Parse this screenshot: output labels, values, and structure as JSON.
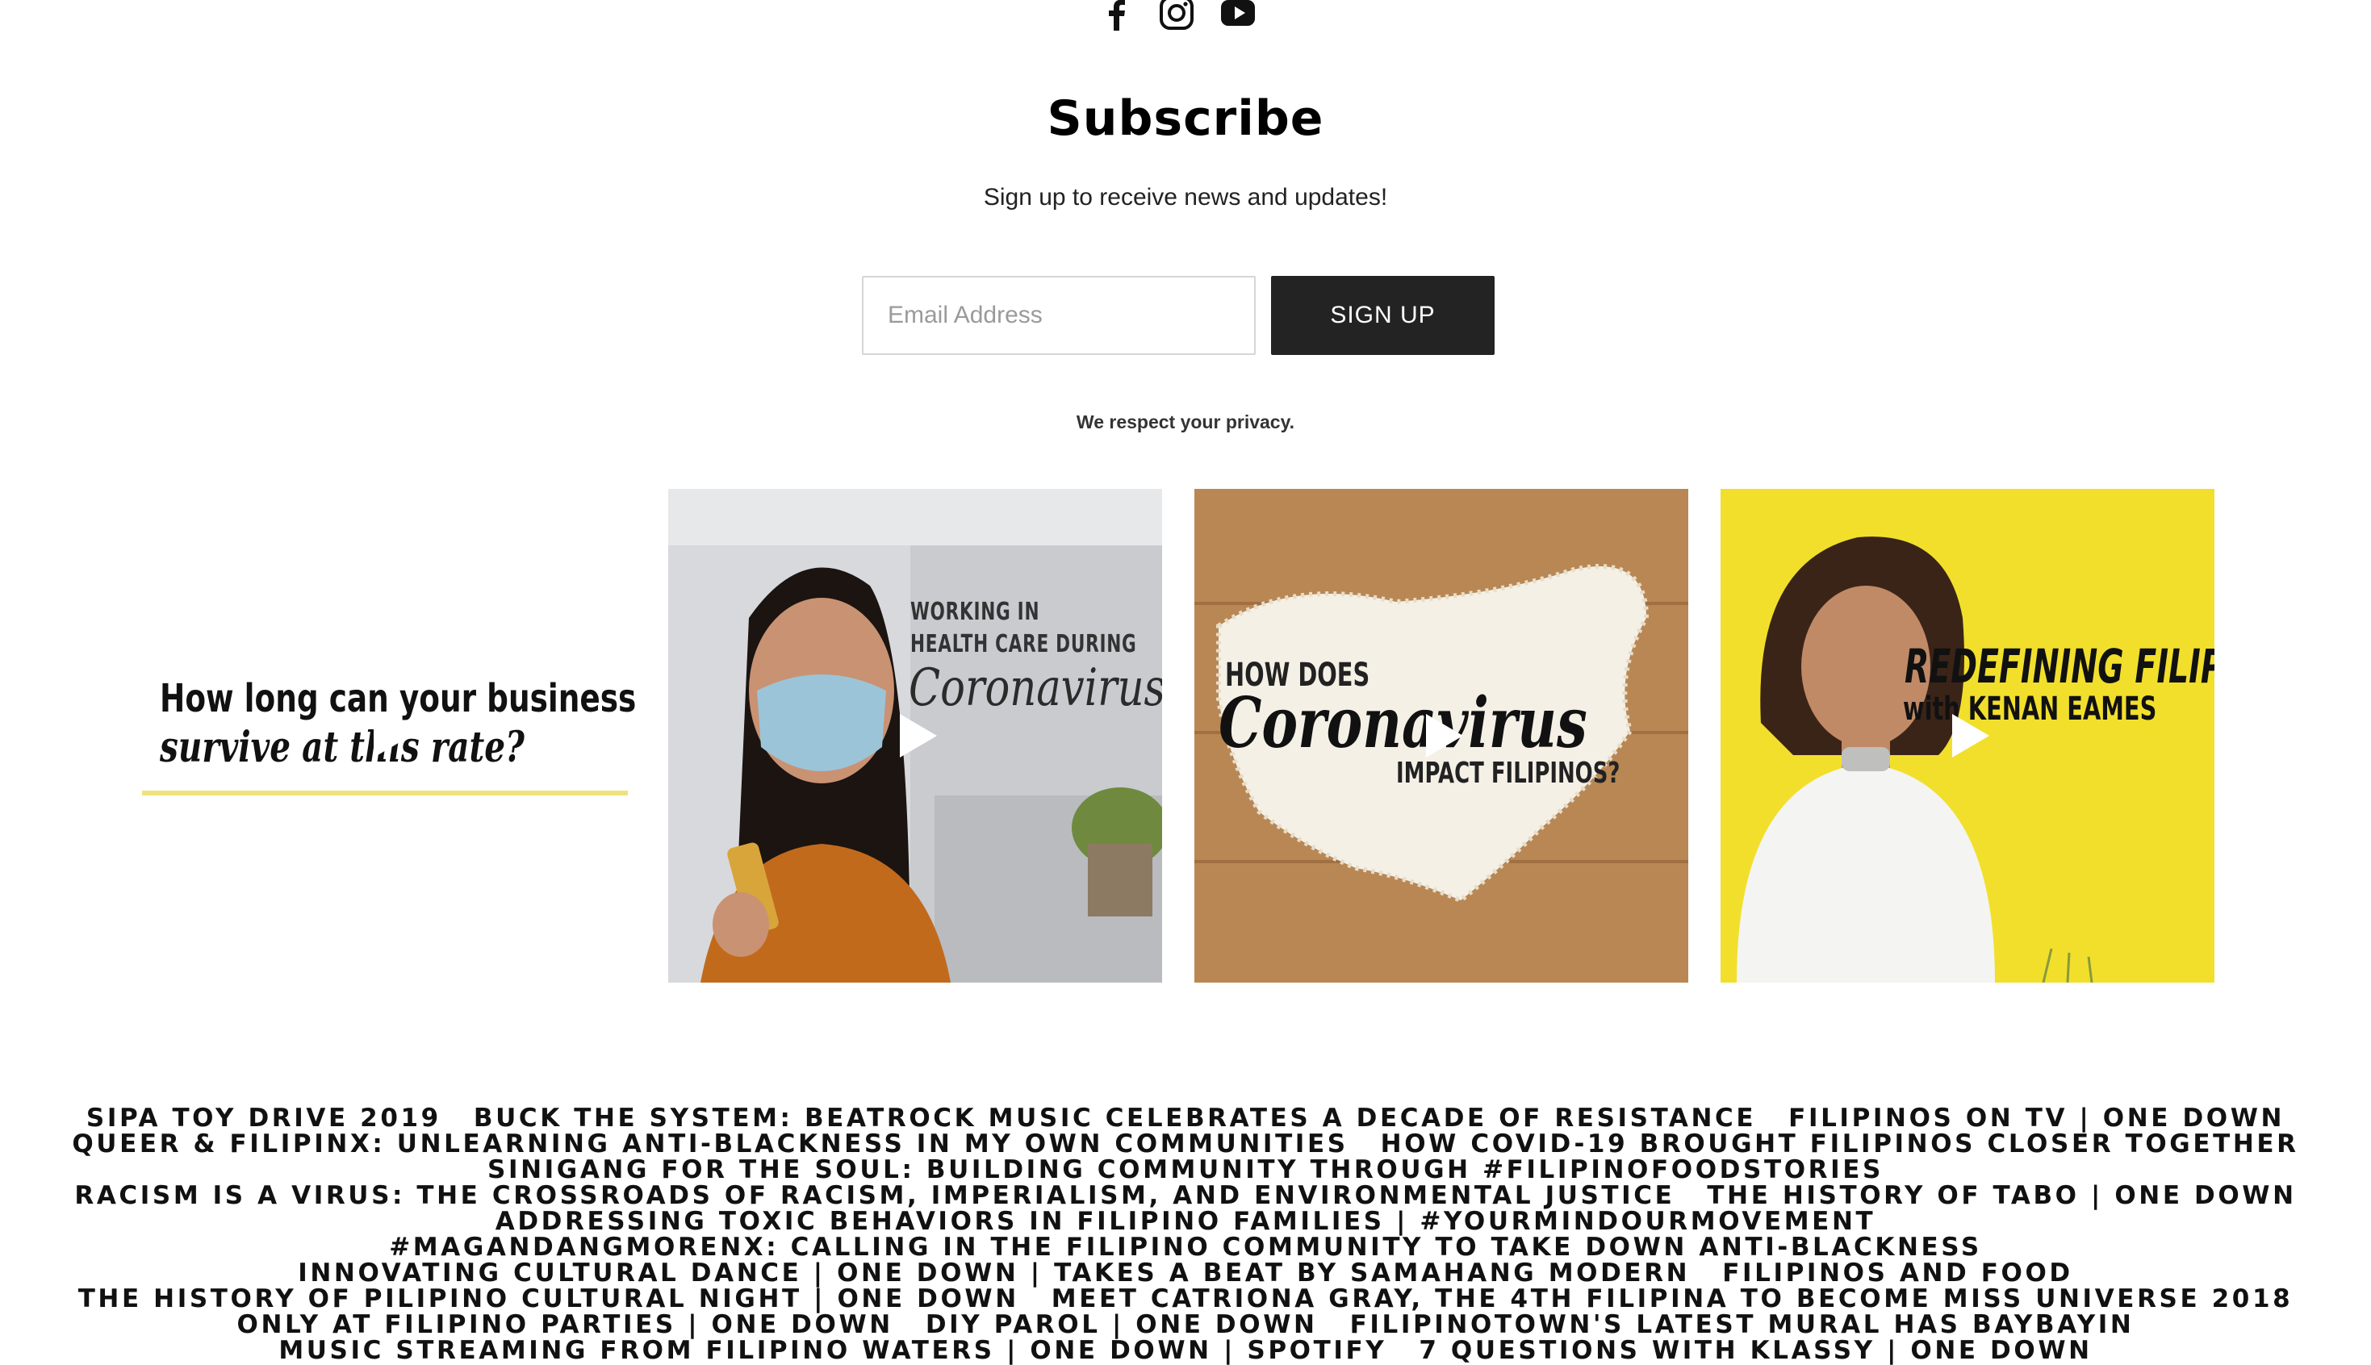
{
  "social": {
    "icons": [
      "facebook-icon",
      "instagram-icon",
      "youtube-icon"
    ]
  },
  "subscribe": {
    "title": "Subscribe",
    "description": "Sign up to receive news and updates!",
    "email_placeholder": "Email Address",
    "button_label": "SIGN UP",
    "privacy_note": "We respect your privacy."
  },
  "instagram": {
    "posts": [
      {
        "line1": "How long can your business",
        "line2": "survive at this rate?",
        "video": true
      },
      {
        "line1": "WORKING IN",
        "line2": "HEALTH CARE DURING",
        "line3": "Coronavirus",
        "video": true
      },
      {
        "line1": "HOW DOES",
        "line2": "Coronavirus",
        "line3": "IMPACT FILIPINOS?",
        "video": true
      },
      {
        "line1": "REDEFINING FILIPINO",
        "line2": "with KENAN EAMES",
        "video": true
      }
    ]
  },
  "footer_links": {
    "rows": [
      [
        "SIPA Toy Drive 2019",
        "Buck the System: Beatrock Music Celebrates a Decade of Resistance",
        "Filipinos on TV | One Down"
      ],
      [
        "Queer & Filipinx: Unlearning Anti-Blackness in My Own Communities",
        "How COVID-19 Brought Filipinos Closer Together"
      ],
      [
        "Sinigang for the Soul: Building Community Through #FilipinoFoodStories"
      ],
      [
        "Racism is a Virus: The Crossroads of Racism, Imperialism, and Environmental Justice",
        "The History of Tabo | One Down"
      ],
      [
        "Addressing Toxic Behaviors in Filipino Families | #YourMindOurMovement"
      ],
      [
        "#MagandangMorenx: Calling in the Filipino Community to Take Down Anti-Blackness"
      ],
      [
        "Innovating Cultural Dance | One Down | Takes a Beat by Samahang Modern",
        "Filipinos and Food"
      ],
      [
        "The History of Pilipino Cultural Night | One Down",
        "Meet Catriona Gray, the 4th Filipina to Become Miss Universe 2018"
      ],
      [
        "Only at Filipino Parties | One Down",
        "DIY Parol | One Down",
        "FilipinoTown's Latest Mural Has Baybayin"
      ],
      [
        "Music Streaming From Filipino Waters | One Down | Spotify",
        "7 Questions with Klassy | One Down"
      ]
    ]
  },
  "colors": {
    "button_bg": "#232323",
    "tile4_bg": "#f2df2c",
    "tile3_bg": "#b98754"
  }
}
